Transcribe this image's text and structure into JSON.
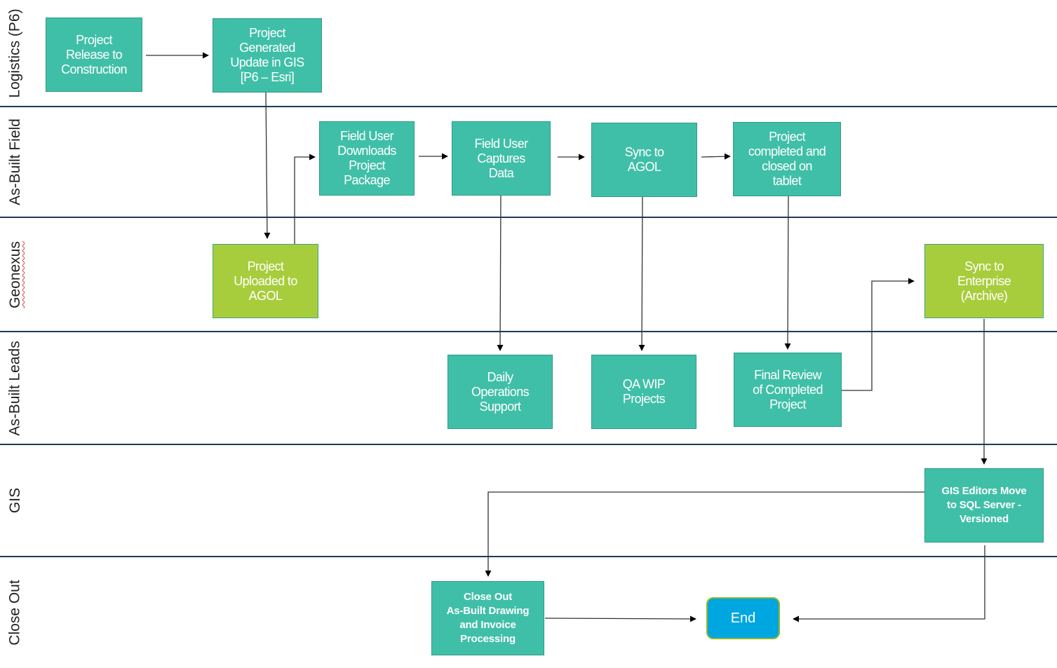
{
  "diagram": {
    "type": "swimlane-flowchart",
    "lanes": [
      {
        "id": "logistics",
        "label": "Logistics (P6)"
      },
      {
        "id": "asbuilt-field",
        "label": "As-Built Field"
      },
      {
        "id": "geonexus",
        "label": "Geonexus"
      },
      {
        "id": "asbuilt-leads",
        "label": "As-Built Leads"
      },
      {
        "id": "gis",
        "label": "GIS"
      },
      {
        "id": "closeout",
        "label": "Close Out"
      }
    ],
    "nodes": {
      "release": {
        "label": "Project\nRelease to\nConstruction",
        "lane": "logistics"
      },
      "generated": {
        "label": "Project\nGenerated\nUpdate in GIS\n[P6 – Esri]",
        "lane": "logistics"
      },
      "downloads": {
        "label": "Field User\nDownloads\nProject\nPackage",
        "lane": "asbuilt-field"
      },
      "captures": {
        "label": "Field User\nCaptures\nData",
        "lane": "asbuilt-field"
      },
      "sync_agol": {
        "label": "Sync to\nAGOL",
        "lane": "asbuilt-field"
      },
      "completed": {
        "label": "Project\ncompleted and\nclosed on\ntablet",
        "lane": "asbuilt-field"
      },
      "uploaded": {
        "label": "Project\nUploaded to\nAGOL",
        "lane": "geonexus"
      },
      "sync_enterprise": {
        "label": "Sync to\nEnterprise\n(Archive)",
        "lane": "geonexus"
      },
      "daily_ops": {
        "label": "Daily\nOperations\nSupport",
        "lane": "asbuilt-leads"
      },
      "qa_wip": {
        "label": "QA WIP\nProjects",
        "lane": "asbuilt-leads"
      },
      "final_review": {
        "label": "Final Review\nof Completed\nProject",
        "lane": "asbuilt-leads"
      },
      "gis_editors": {
        "label": "GIS Editors Move\nto SQL Server -\nVersioned",
        "lane": "gis"
      },
      "closeout_proc": {
        "label": "Close Out\nAs-Built Drawing\nand Invoice\nProcessing",
        "lane": "closeout"
      },
      "end": {
        "label": "End",
        "lane": "closeout"
      }
    },
    "edges": [
      {
        "from": "release",
        "to": "generated"
      },
      {
        "from": "generated",
        "to": "uploaded"
      },
      {
        "from": "uploaded",
        "to": "downloads"
      },
      {
        "from": "downloads",
        "to": "captures"
      },
      {
        "from": "captures",
        "to": "sync_agol"
      },
      {
        "from": "sync_agol",
        "to": "completed"
      },
      {
        "from": "captures",
        "to": "daily_ops"
      },
      {
        "from": "sync_agol",
        "to": "qa_wip"
      },
      {
        "from": "completed",
        "to": "final_review"
      },
      {
        "from": "final_review",
        "to": "sync_enterprise"
      },
      {
        "from": "sync_enterprise",
        "to": "gis_editors"
      },
      {
        "from": "gis_editors",
        "to": "closeout_proc"
      },
      {
        "from": "gis_editors",
        "to": "end"
      },
      {
        "from": "closeout_proc",
        "to": "end"
      }
    ],
    "colors": {
      "process": "#40bfa8",
      "geonexus_process": "#a8cd3c",
      "terminal": "#00a6e0",
      "lane_divider": "#1f3a57"
    }
  }
}
